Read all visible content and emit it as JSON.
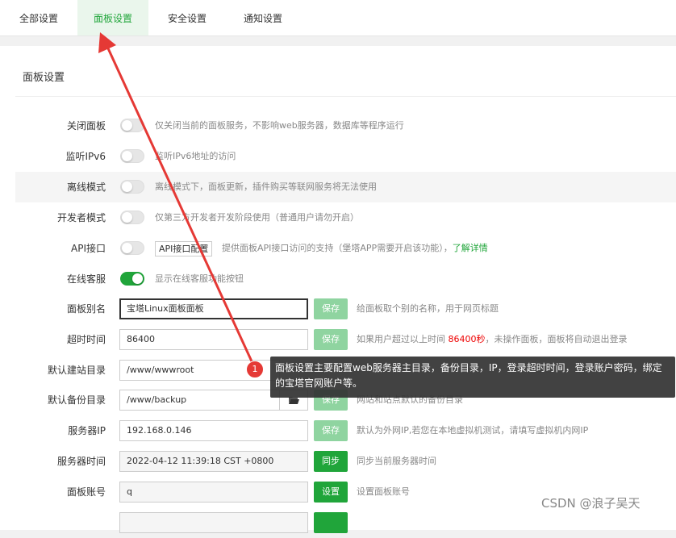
{
  "tabs": [
    {
      "label": "全部设置"
    },
    {
      "label": "面板设置"
    },
    {
      "label": "安全设置"
    },
    {
      "label": "通知设置"
    }
  ],
  "panel": {
    "title": "面板设置",
    "rows": {
      "close_panel": {
        "label": "关闭面板",
        "desc": "仅关闭当前的面板服务，不影响web服务器，数据库等程序运行"
      },
      "ipv6": {
        "label": "监听IPv6",
        "desc": "监听IPv6地址的访问"
      },
      "offline": {
        "label": "离线模式",
        "desc": "离线模式下，面板更新，插件购买等联网服务将无法使用"
      },
      "developer": {
        "label": "开发者模式",
        "desc": "仅第三方开发者开发阶段使用（普通用户请勿开启）"
      },
      "api": {
        "label": "API接口",
        "button": "API接口配置",
        "desc": "提供面板API接口访问的支持（堡塔APP需要开启该功能），",
        "link": "了解详情"
      },
      "online_service": {
        "label": "在线客服",
        "desc": "显示在线客服功能按钮"
      },
      "alias": {
        "label": "面板别名",
        "value": "宝塔Linux面板面板",
        "button": "保存",
        "desc": "给面板取个别的名称，用于网页标题"
      },
      "timeout": {
        "label": "超时时间",
        "value": "86400",
        "button": "保存",
        "desc_pre": "如果用户超过以上时间 ",
        "desc_red": "86400秒",
        "desc_post": "，未操作面板，面板将自动退出登录"
      },
      "site_dir": {
        "label": "默认建站目录",
        "value": "/www/wwwroot"
      },
      "backup_dir": {
        "label": "默认备份目录",
        "value": "/www/backup",
        "button": "保存",
        "desc": "网站和站点默认的备份目录"
      },
      "server_ip": {
        "label": "服务器IP",
        "value": "192.168.0.146",
        "button": "保存",
        "desc": "默认为外网IP,若您在本地虚拟机测试，请填写虚拟机内网IP"
      },
      "server_time": {
        "label": "服务器时间",
        "value": "2022-04-12 11:39:18 CST +0800",
        "button": "同步",
        "desc": "同步当前服务器时间"
      },
      "account": {
        "label": "面板账号",
        "value": "q",
        "button": "设置",
        "desc": "设置面板账号"
      }
    }
  },
  "annotation": {
    "number": "1",
    "text": "面板设置主要配置web服务器主目录，备份目录，IP，登录超时时间，登录账户密码，绑定的宝塔官网账户等。"
  },
  "watermark": "CSDN @浪子吴天",
  "colors": {
    "accent": "#20a53a",
    "annotation_red": "#e53935"
  }
}
